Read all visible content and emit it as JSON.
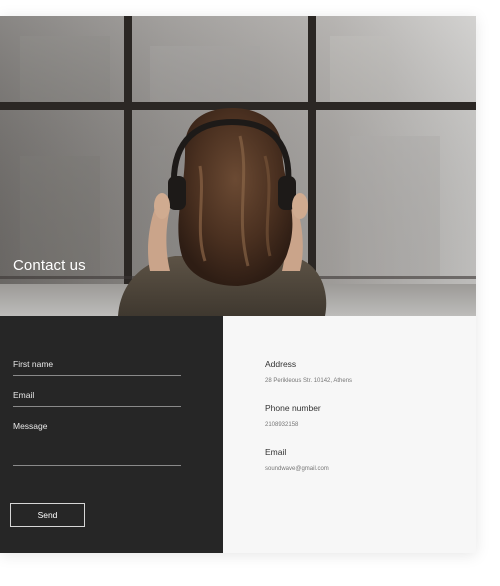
{
  "hero": {
    "title": "Contact us"
  },
  "form": {
    "first_name_label": "First name",
    "email_label": "Email",
    "message_label": "Message",
    "send_label": "Send"
  },
  "info": {
    "address_label": "Address",
    "address_value": "28 Perikleous Str. 10142, Athens",
    "phone_label": "Phone number",
    "phone_value": "2108932158",
    "email_label": "Email",
    "email_value": "soundwave@gmail.com"
  },
  "colors": {
    "form_background": "#262626",
    "info_background": "#f7f7f7",
    "text_light": "#ffffff",
    "text_dark": "#333333",
    "text_muted": "#777777"
  }
}
